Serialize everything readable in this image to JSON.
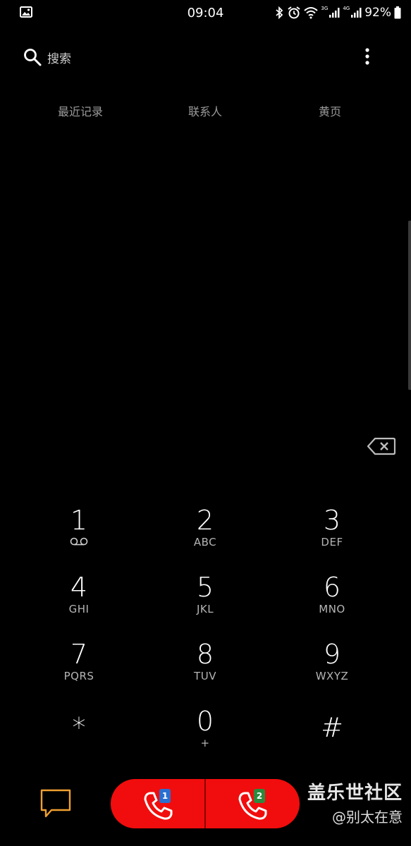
{
  "status_bar": {
    "time": "09:04",
    "battery_percent": "92%",
    "sim1_network": "3G",
    "sim2_network": "4G",
    "icons": [
      "gallery-icon",
      "bluetooth-icon",
      "alarm-icon",
      "wifi-icon",
      "signal-icon",
      "battery-icon"
    ]
  },
  "search": {
    "label": "搜索"
  },
  "tabs": [
    {
      "label": "最近记录"
    },
    {
      "label": "联系人"
    },
    {
      "label": "黄页"
    }
  ],
  "dialpad": {
    "keys": [
      {
        "digit": "1",
        "letters": ""
      },
      {
        "digit": "2",
        "letters": "ABC"
      },
      {
        "digit": "3",
        "letters": "DEF"
      },
      {
        "digit": "4",
        "letters": "GHI"
      },
      {
        "digit": "5",
        "letters": "JKL"
      },
      {
        "digit": "6",
        "letters": "MNO"
      },
      {
        "digit": "7",
        "letters": "PQRS"
      },
      {
        "digit": "8",
        "letters": "TUV"
      },
      {
        "digit": "9",
        "letters": "WXYZ"
      },
      {
        "digit": "*",
        "letters": ""
      },
      {
        "digit": "0",
        "letters": "+"
      },
      {
        "digit": "#",
        "letters": ""
      }
    ]
  },
  "call_buttons": {
    "sim1_label": "1",
    "sim2_label": "2",
    "color": "#f10d0d"
  },
  "colors": {
    "background": "#000000",
    "message_icon": "#f0a030",
    "tab_text": "#9a9a9a"
  },
  "watermark": {
    "title": "盖乐世社区",
    "user": "@别太在意"
  }
}
